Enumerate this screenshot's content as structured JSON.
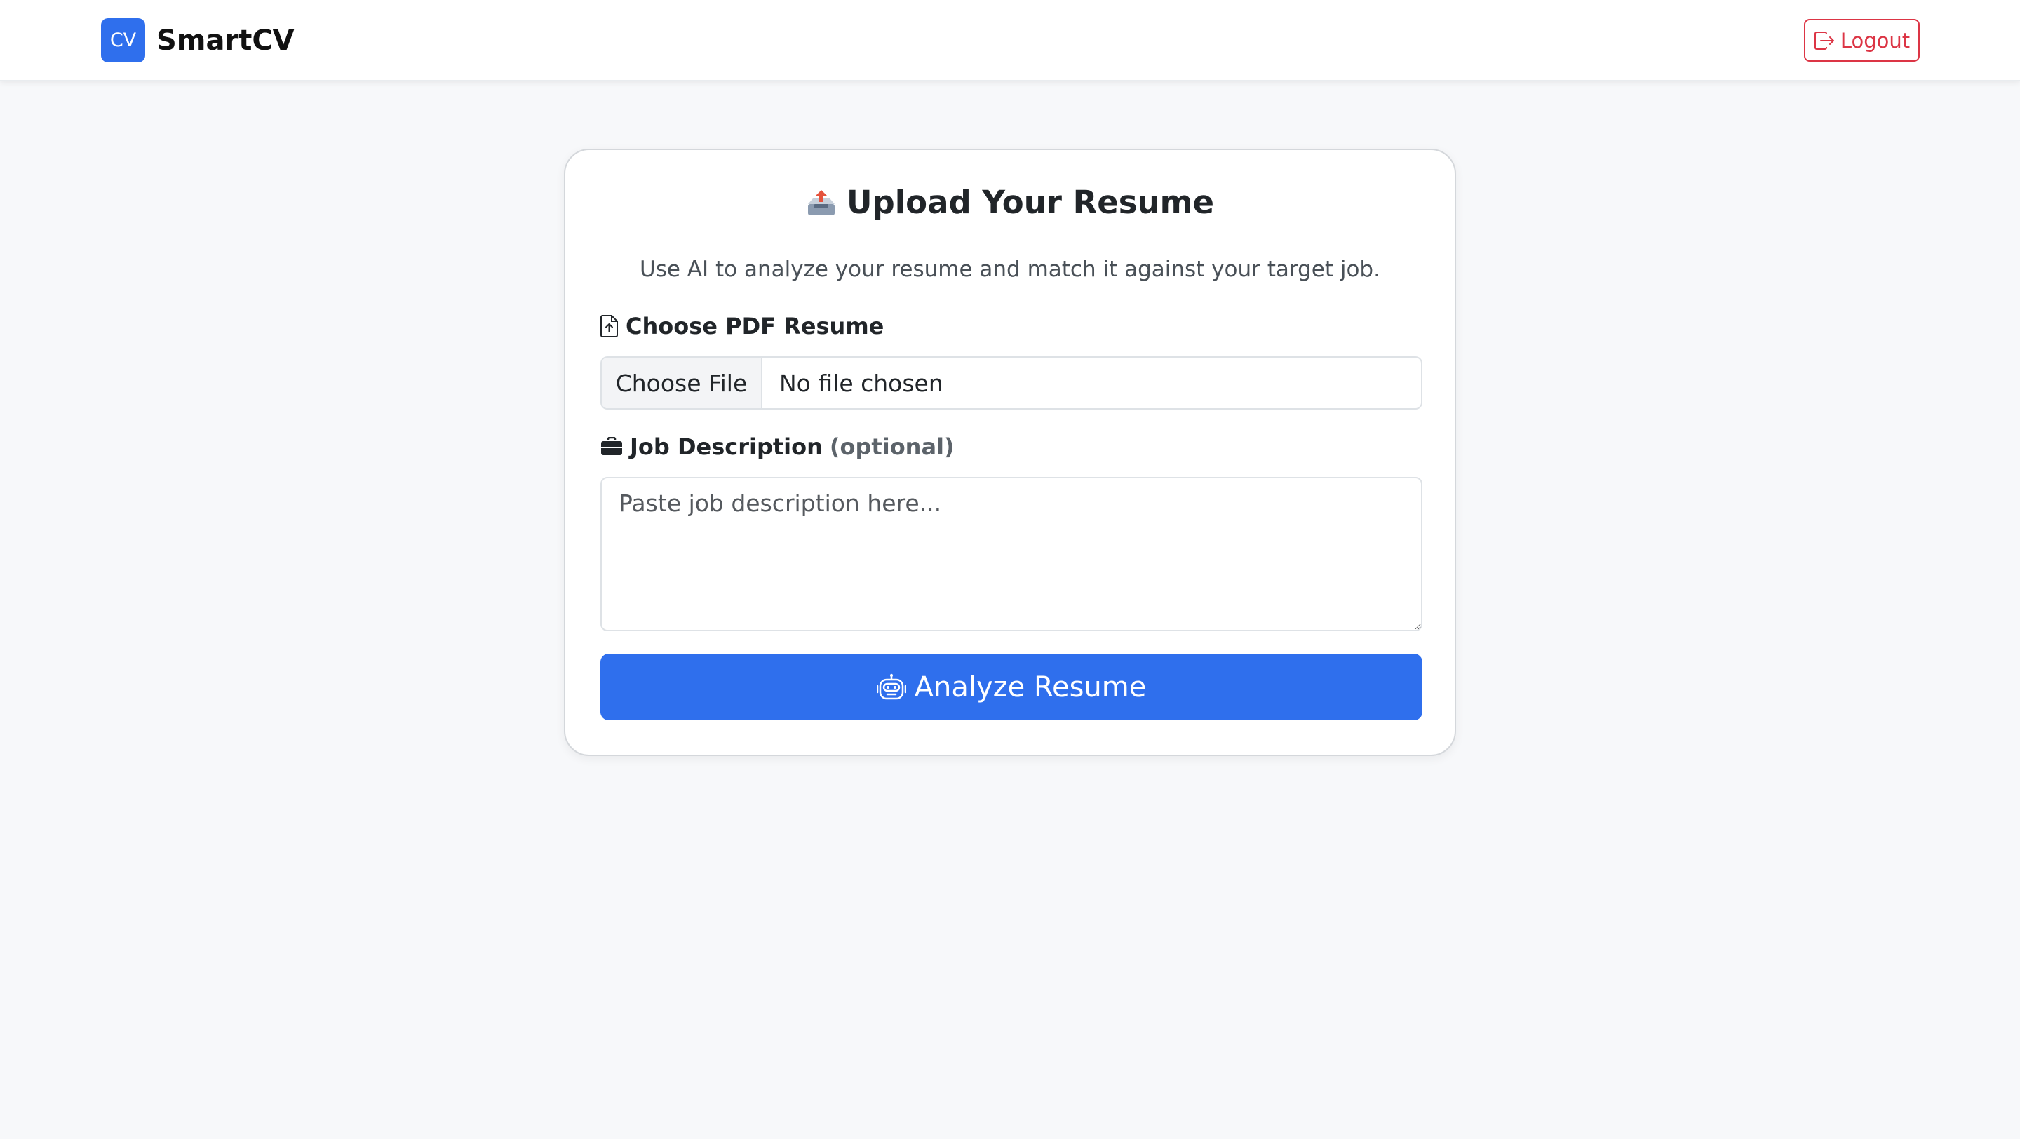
{
  "navbar": {
    "logo_text": "CV",
    "brand_name": "SmartCV",
    "logout_label": "Logout"
  },
  "upload_card": {
    "title": "Upload Your Resume",
    "subtitle": "Use AI to analyze your resume and match it against your target job.",
    "resume_field": {
      "label": "Choose PDF Resume",
      "choose_button_label": "Choose File",
      "status_text": "No file chosen",
      "icon": "file-upload-icon"
    },
    "job_description_field": {
      "label": "Job Description",
      "optional_label": "(optional)",
      "placeholder": "Paste job description here...",
      "value": "",
      "icon": "briefcase-icon"
    },
    "analyze_button_label": "Analyze Resume",
    "analyze_button_icon": "robot-icon",
    "title_icon": "inbox-tray-icon"
  },
  "colors": {
    "primary": "#2f6fed",
    "danger": "#dc3545",
    "page_background": "#f7f8fa",
    "card_background": "#ffffff"
  }
}
